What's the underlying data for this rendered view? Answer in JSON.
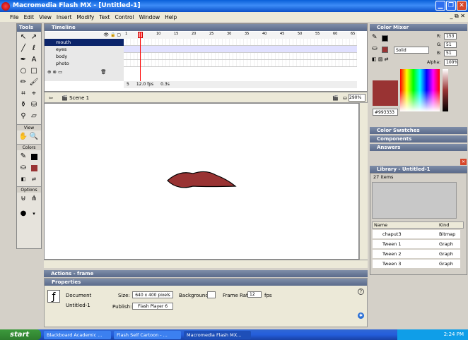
{
  "window": {
    "title": "Macromedia Flash MX - [Untitled-1]",
    "doc_controls": "_ ⧉ ✕"
  },
  "menu": [
    "File",
    "Edit",
    "View",
    "Insert",
    "Modify",
    "Text",
    "Control",
    "Window",
    "Help"
  ],
  "tools": {
    "title": "Tools",
    "sections": [
      "View",
      "Colors",
      "Options"
    ]
  },
  "timeline": {
    "title": "Timeline",
    "layers": [
      {
        "name": "mouth",
        "selected": true
      },
      {
        "name": "eyes"
      },
      {
        "name": "body"
      },
      {
        "name": "photo"
      }
    ],
    "frame_numbers": [
      "1",
      "5",
      "10",
      "15",
      "20",
      "25",
      "30",
      "35",
      "40",
      "45",
      "50",
      "55",
      "60",
      "65"
    ],
    "current_frame": "5",
    "fps": "12.0 fps",
    "time": "0.3s"
  },
  "edit_bar": {
    "scene": "Scene 1",
    "zoom": "290%"
  },
  "panels": {
    "actions": "Actions - frame",
    "properties": "Properties",
    "color_mixer": "Color Mixer",
    "color_swatches": "Color Swatches",
    "components": "Components",
    "answers": "Answers"
  },
  "mixer": {
    "r_label": "R:",
    "r": "153",
    "g_label": "G:",
    "g": "51",
    "b_label": "B:",
    "b": "51",
    "alpha_label": "Alpha:",
    "alpha": "100%",
    "fill_type": "Solid",
    "hex": "#993333"
  },
  "properties": {
    "doc_label": "Document",
    "doc_name": "Untitled-1",
    "size_label": "Size:",
    "size_value": "640 x 400 pixels",
    "bg_label": "Background:",
    "framerate_label": "Frame Rate:",
    "framerate_value": "12",
    "fps_label": "fps",
    "publish_label": "Publish:",
    "publish_value": "Flash Player 6"
  },
  "library": {
    "title": "Library - Untitled-1",
    "count": "27 items",
    "col_name": "Name",
    "col_kind": "Kind",
    "items": [
      {
        "name": "chaput3",
        "kind": "Bitmap"
      },
      {
        "name": "Tween 1",
        "kind": "Graph"
      },
      {
        "name": "Tween 2",
        "kind": "Graph"
      },
      {
        "name": "Tween 3",
        "kind": "Graph"
      }
    ]
  },
  "taskbar": {
    "start": "start",
    "tasks": [
      "Blackboard Academic ...",
      "Flash Self Cartoon - ...",
      "Macromedia Flash MX..."
    ],
    "clock": "2:24 PM"
  },
  "colors": {
    "accent": "#993333",
    "titlebar": "#0a5fd8",
    "selection": "#0b246a"
  }
}
